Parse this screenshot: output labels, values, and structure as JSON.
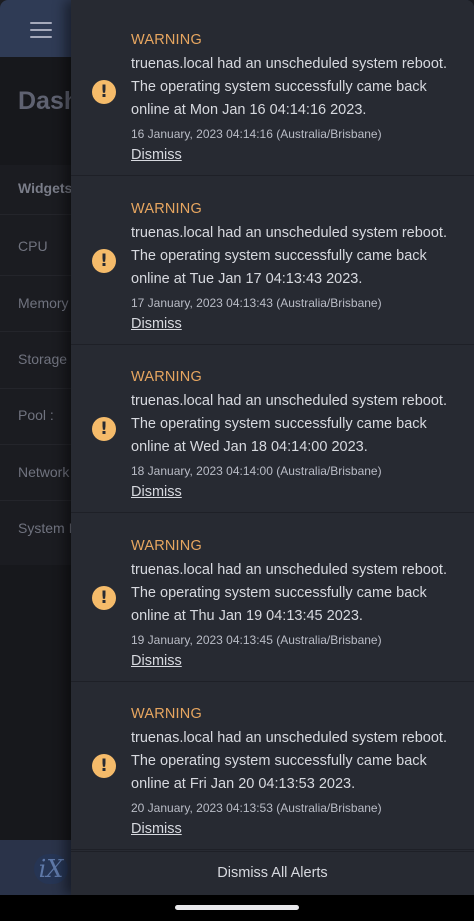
{
  "app": {
    "page_title": "Dash",
    "widgets_heading": "Widgets",
    "widget_items": [
      "CPU",
      "Memory",
      "Storage",
      "Pool :",
      "Network",
      "System I"
    ],
    "footer_logo": "iX"
  },
  "alerts": [
    {
      "level": "WARNING",
      "message": "truenas.local had an unscheduled system reboot. The operating system successfully came back online at Mon Jan 16 04:14:16 2023.",
      "timestamp": "16 January, 2023 04:14:16 (Australia/Brisbane)",
      "dismiss_label": "Dismiss"
    },
    {
      "level": "WARNING",
      "message": "truenas.local had an unscheduled system reboot. The operating system successfully came back online at Tue Jan 17 04:13:43 2023.",
      "timestamp": "17 January, 2023 04:13:43 (Australia/Brisbane)",
      "dismiss_label": "Dismiss"
    },
    {
      "level": "WARNING",
      "message": "truenas.local had an unscheduled system reboot. The operating system successfully came back online at Wed Jan 18 04:14:00 2023.",
      "timestamp": "18 January, 2023 04:14:00 (Australia/Brisbane)",
      "dismiss_label": "Dismiss"
    },
    {
      "level": "WARNING",
      "message": "truenas.local had an unscheduled system reboot. The operating system successfully came back online at Thu Jan 19 04:13:45 2023.",
      "timestamp": "19 January, 2023 04:13:45 (Australia/Brisbane)",
      "dismiss_label": "Dismiss"
    },
    {
      "level": "WARNING",
      "message": "truenas.local had an unscheduled system reboot. The operating system successfully came back online at Fri Jan 20 04:13:53 2023.",
      "timestamp": "20 January, 2023 04:13:53 (Australia/Brisbane)",
      "dismiss_label": "Dismiss"
    }
  ],
  "dismiss_all_label": "Dismiss All Alerts",
  "icons": {
    "menu": "hamburger-menu-icon",
    "alert": "warning-icon"
  },
  "colors": {
    "warning_icon": "#f5bb6a",
    "warning_text": "#e7a660",
    "panel_bg": "#272a32",
    "topbar_bg": "#2f3b55"
  }
}
